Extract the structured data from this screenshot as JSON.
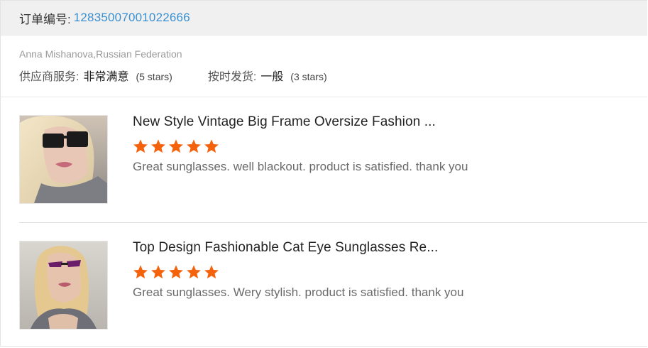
{
  "order": {
    "label": "订单编号:",
    "number": "12835007001022666"
  },
  "buyer": {
    "name_country": "Anna Mishanova,Russian Federation"
  },
  "ratings": [
    {
      "label": "供应商服务:",
      "value": "非常满意",
      "stars_text": "(5 stars)"
    },
    {
      "label": "按时发货:",
      "value": "一般",
      "stars_text": "(3 stars)"
    }
  ],
  "reviews": [
    {
      "product_title": "New Style Vintage Big Frame Oversize Fashion ...",
      "rating": 5,
      "comment": "Great sunglasses. well blackout. product is satisfied. thank you"
    },
    {
      "product_title": "Top Design Fashionable Cat Eye Sunglasses Re...",
      "rating": 5,
      "comment": "Great sunglasses. Wery stylish. product is satisfied. thank you"
    }
  ],
  "colors": {
    "star": "#f5620c",
    "order_number": "#3a8fd0",
    "header_bg": "#f0f0f0"
  },
  "icons": {
    "star": "star-icon"
  }
}
